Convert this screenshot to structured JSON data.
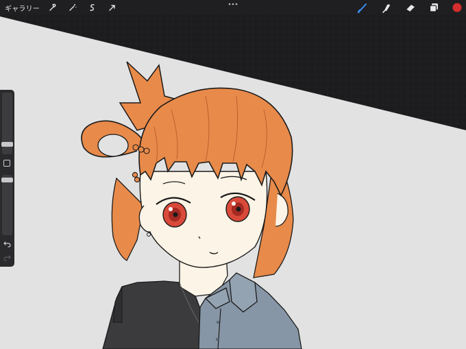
{
  "toolbar": {
    "gallery_label": "ギャラリー",
    "left_tools": [
      "wrench-icon",
      "magic-wand-icon",
      "selection-icon",
      "transform-arrow-icon"
    ],
    "right_tools": [
      "brush-icon",
      "smudge-icon",
      "eraser-icon",
      "layers-icon",
      "color-swatch"
    ],
    "active_tool": "brush-icon",
    "brush_accent_color": "#3a8ef6",
    "current_color": "#d42d2d"
  },
  "sidebar": {
    "controls": [
      "brush-size-slider",
      "modify-button",
      "opacity-slider",
      "undo-icon",
      "redo-icon"
    ],
    "brush_size_level": 0.38,
    "opacity_level": 0.93
  },
  "canvas": {
    "background_color": "#e2e2e2",
    "hair_color": "#e88a4a",
    "skin_color": "#fcf4e6",
    "eye_color": "#d94a3a",
    "shirt_color": "#8796a6",
    "dark_garment_color": "#3a3a3a"
  }
}
